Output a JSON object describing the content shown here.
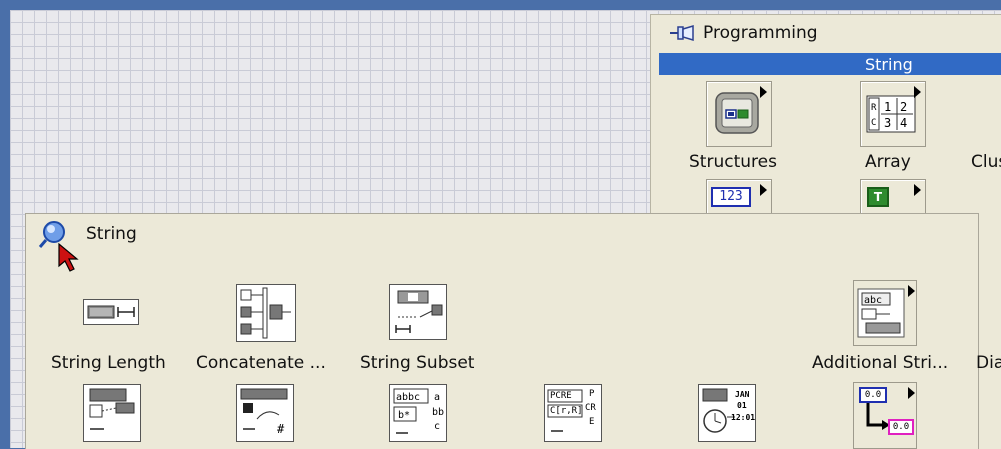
{
  "programming_palette": {
    "title": "Programming",
    "highlighted_item": "String",
    "items": [
      {
        "label": "Structures",
        "icon": "structures-icon"
      },
      {
        "label": "Array",
        "icon": "array-icon"
      },
      {
        "label": "Clus",
        "icon": "cluster-icon"
      }
    ],
    "second_row": [
      {
        "label": "123",
        "icon": "numeric-icon"
      },
      {
        "label": "T",
        "icon": "boolean-icon"
      }
    ]
  },
  "string_palette": {
    "title": "String",
    "row1": [
      {
        "label": "String Length",
        "icon": "string-length-icon"
      },
      {
        "label": "Concatenate ...",
        "icon": "concatenate-strings-icon"
      },
      {
        "label": "String Subset",
        "icon": "string-subset-icon"
      },
      {
        "label": "Additional Stri...",
        "icon": "additional-string-functions-icon"
      },
      {
        "label": "Dia",
        "icon": "dialog-icon"
      }
    ],
    "row2": [
      {
        "icon": "match-pattern-icon"
      },
      {
        "icon": "search-replace-icon"
      },
      {
        "icon": "format-into-string-icon"
      },
      {
        "label_lines": [
          "PCRE",
          "C[r,R]",
          "P",
          "CR",
          "E"
        ],
        "icon": "match-regular-expression-icon"
      },
      {
        "label_lines": [
          "JAN",
          "01",
          "12:01"
        ],
        "icon": "format-date-time-icon"
      },
      {
        "label_lines": [
          "0.0",
          "0.0"
        ],
        "icon": "string-number-conversion-icon"
      }
    ]
  },
  "colors": {
    "desktop_blue": "#4a6fa9",
    "palette_bg": "#ece9d8",
    "highlight": "#316ac5",
    "cursor_red": "#cc1111"
  }
}
